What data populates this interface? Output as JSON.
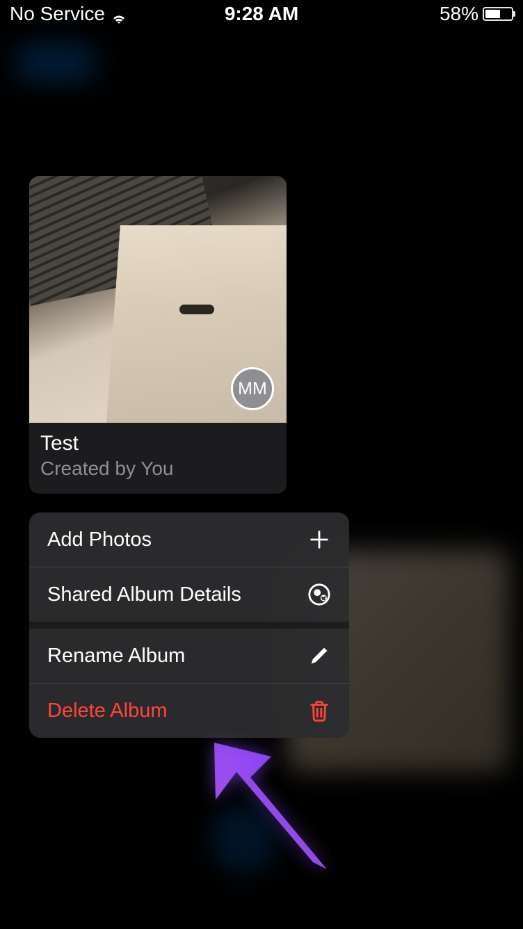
{
  "status": {
    "carrier": "No Service",
    "time": "9:28 AM",
    "battery_pct": "58%",
    "battery_level_width": "58%"
  },
  "album": {
    "title": "Test",
    "subtitle": "Created by You",
    "badge_initials": "MM"
  },
  "menu": {
    "add_photos": "Add Photos",
    "album_details": "Shared Album Details",
    "rename": "Rename Album",
    "delete": "Delete Album"
  }
}
